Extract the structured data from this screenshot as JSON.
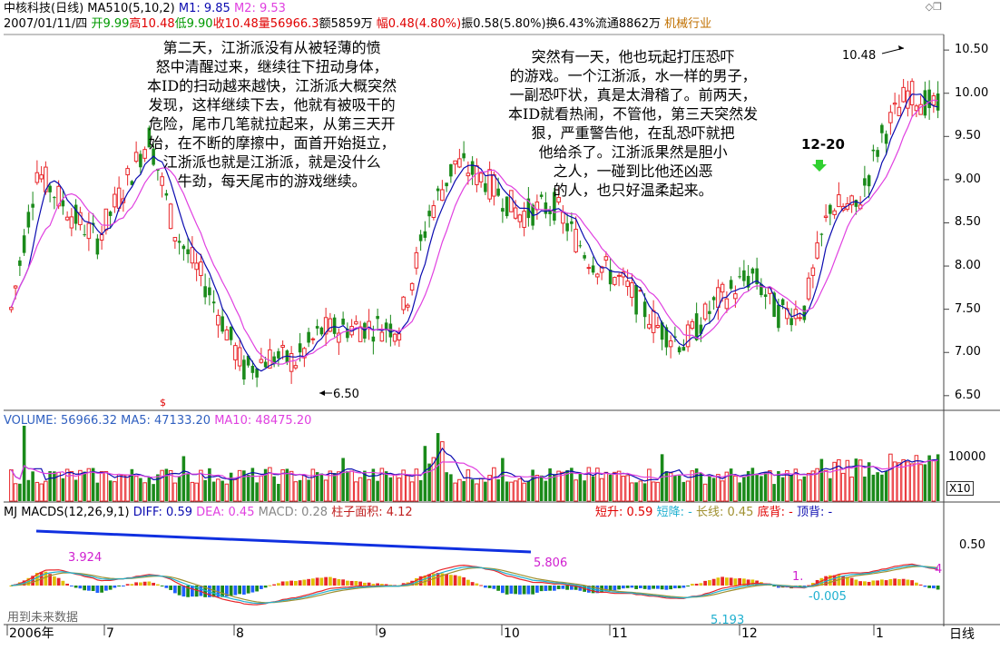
{
  "header": {
    "title": "中核科技(日线)",
    "ma_label": "MA510(5,10,2)",
    "m1": "M1: 9.85",
    "m2": "M2: 9.53",
    "date": "2007/01/11/四",
    "open": "开9.99",
    "high": "高10.48",
    "low": "低9.90",
    "close": "收10.48",
    "volume": "量56966.3",
    "amount": "额5859万",
    "change_pct": "幅0.48(4.80%)",
    "amplitude": "振0.58(5.80%)",
    "turnover": "换6.43%",
    "float": "流通8862万",
    "industry": "机械行业"
  },
  "price_axis": {
    "labels": [
      "10.50",
      "10.00",
      "9.50",
      "9.00",
      "8.50",
      "8.00",
      "7.50",
      "7.00",
      "6.50"
    ],
    "range": [
      6.33,
      10.68
    ]
  },
  "annotations": {
    "high_marker": "10.48",
    "low_marker": "6.50",
    "date_marker": "12-20",
    "ex_rights": "$"
  },
  "notes": {
    "left": [
      "第二天，江浙派没有从被轻薄的愤",
      "怒中清醒过来，继续往下扭动身体，",
      "本ID的扫动越来越快，江浙派大概突然",
      "发现，这样继续下去，他就有被吸干的",
      "危险，尾市几笔就拉起来，从第三天开",
      "始，在不断的摩擦中，面首开始挺立，",
      "江浙派也就是江浙派，就是没什么",
      "牛劲，每天尾市的游戏继续。"
    ],
    "right": [
      "突然有一天，他也玩起打压恐吓",
      "的游戏。一个江浙派，水一样的男子，",
      "一副恐吓状，真是太滑稽了。前两天，",
      "本ID就看热闹，不管他，第三天突然发",
      "狠，严重警告他，在乱恐吓就把",
      "他给杀了。江浙派果然是胆小",
      "之人，一碰到比他还凶恶",
      "的人，也只好温柔起来。"
    ]
  },
  "volume_panel": {
    "title": "VOLUME: 56966.32",
    "ma5": "MA5: 47133.20",
    "ma10": "MA10: 48475.20",
    "axis_label": "10000",
    "multiplier": "X10"
  },
  "macd_panel": {
    "name": "MJ",
    "title": "MACDS(12,26,9,1)",
    "diff": "DIFF: 0.59",
    "dea": "DEA: 0.45",
    "macd": "MACD: 0.28",
    "area": "柱子面积: 4.12",
    "short_up": "短升: 0.59",
    "short_down": "短降: -",
    "long_line": "长线: 0.45",
    "bottom_div": "底背: -",
    "top_div": "顶背: -",
    "axis_label": "0.50",
    "val_3924": "3.924",
    "val_5806": "5.806",
    "val_m0005": "-0.005",
    "val_5193": "5.193",
    "val_1": "1.",
    "val_4": "4",
    "future_note": "用到未来数据"
  },
  "time_axis": {
    "labels": [
      "2006年",
      "7",
      "8",
      "9",
      "10",
      "11",
      "12",
      "1"
    ],
    "period": "日线"
  },
  "colors": {
    "up": "#e8262a",
    "down": "#1a8a1a",
    "ma5": "#0b0bb0",
    "ma10": "#e040e0",
    "text_red": "#e00000",
    "text_green": "#009900",
    "text_magenta": "#d020d0",
    "text_orange": "#c07000",
    "cyan": "#20b0d0",
    "olive": "#a09030",
    "bar_yellow": "#e0c000",
    "bar_blue": "#2060ff"
  }
}
